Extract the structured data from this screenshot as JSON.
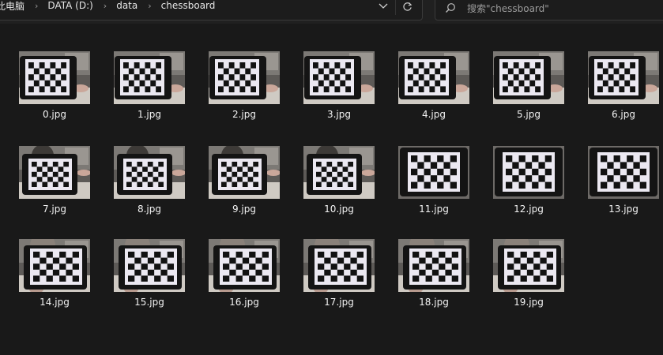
{
  "breadcrumb": {
    "items": [
      "此电脑",
      "DATA (D:)",
      "data",
      "chessboard"
    ]
  },
  "search": {
    "placeholder": "搜索\"chessboard\""
  },
  "files": [
    {
      "name": "0.jpg",
      "variant": "dark-phone-left"
    },
    {
      "name": "1.jpg",
      "variant": "dark-phone-left"
    },
    {
      "name": "2.jpg",
      "variant": "dark-phone-left"
    },
    {
      "name": "3.jpg",
      "variant": "dark-phone-left"
    },
    {
      "name": "4.jpg",
      "variant": "dark-phone-left"
    },
    {
      "name": "5.jpg",
      "variant": "dark-phone-left"
    },
    {
      "name": "6.jpg",
      "variant": "dark-phone-left"
    },
    {
      "name": "7.jpg",
      "variant": "angled"
    },
    {
      "name": "8.jpg",
      "variant": "angled"
    },
    {
      "name": "9.jpg",
      "variant": "angled"
    },
    {
      "name": "10.jpg",
      "variant": "angled"
    },
    {
      "name": "11.jpg",
      "variant": "bright-wide"
    },
    {
      "name": "12.jpg",
      "variant": "bright-wide"
    },
    {
      "name": "13.jpg",
      "variant": "bright-wide"
    },
    {
      "name": "14.jpg",
      "variant": "near-face"
    },
    {
      "name": "15.jpg",
      "variant": "near-face"
    },
    {
      "name": "16.jpg",
      "variant": "near-face"
    },
    {
      "name": "17.jpg",
      "variant": "near-face"
    },
    {
      "name": "18.jpg",
      "variant": "near-face"
    },
    {
      "name": "19.jpg",
      "variant": "near-face"
    }
  ],
  "colors": {
    "background": "#191919",
    "toolbar": "#202020",
    "text": "#f2f2f2",
    "muted": "#9c9c9c",
    "chess_light": "#e9e6ef",
    "chess_dark": "#141414"
  }
}
